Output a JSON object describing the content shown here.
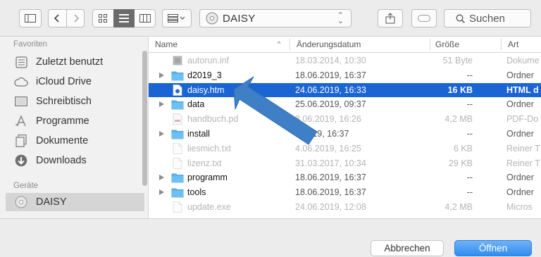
{
  "toolbar": {
    "path_label": "DAISY",
    "search_placeholder": "Suchen"
  },
  "sidebar": {
    "favorites_heading": "Favoriten",
    "favorites": [
      {
        "label": "Zuletzt benutzt",
        "icon": "recent-icon"
      },
      {
        "label": "iCloud Drive",
        "icon": "cloud-icon"
      },
      {
        "label": "Schreibtisch",
        "icon": "desktop-icon"
      },
      {
        "label": "Programme",
        "icon": "applications-icon"
      },
      {
        "label": "Dokumente",
        "icon": "documents-icon"
      },
      {
        "label": "Downloads",
        "icon": "downloads-icon"
      }
    ],
    "devices_heading": "Geräte",
    "devices": [
      {
        "label": "DAISY",
        "icon": "disc-icon"
      }
    ]
  },
  "columns": {
    "name": "Name",
    "date": "Änderungsdatum",
    "size": "Größe",
    "kind": "Art"
  },
  "files": [
    {
      "name": "autorun.inf",
      "date": "18.03.2014, 10:30",
      "size": "51 Byte",
      "kind": "Dokume",
      "type": "doc",
      "enabled": false
    },
    {
      "name": "d2019_3",
      "date": "18.06.2019, 16:37",
      "size": "--",
      "kind": "Ordner",
      "type": "folder",
      "enabled": true
    },
    {
      "name": "daisy.htm",
      "date": "24.06.2019, 16:33",
      "size": "16 KB",
      "kind": "HTML d",
      "type": "html",
      "enabled": true,
      "selected": true
    },
    {
      "name": "data",
      "date": "25.06.2019, 09:37",
      "size": "--",
      "kind": "Ordner",
      "type": "folder",
      "enabled": true
    },
    {
      "name": "handbuch.pd",
      "date": "8.06.2019, 16:26",
      "size": "4,2 MB",
      "kind": "PDF-Do",
      "type": "pdf",
      "enabled": false
    },
    {
      "name": "install",
      "date": "6.2019, 16:37",
      "size": "--",
      "kind": "Ordner",
      "type": "folder",
      "enabled": true
    },
    {
      "name": "liesmich.txt",
      "date": "4.06.2019, 16:25",
      "size": "6 KB",
      "kind": "Reiner T",
      "type": "txt",
      "enabled": false
    },
    {
      "name": "lizenz.txt",
      "date": "31.03.2017, 10:34",
      "size": "29 KB",
      "kind": "Reiner T",
      "type": "txt",
      "enabled": false
    },
    {
      "name": "programm",
      "date": "18.06.2019, 16:37",
      "size": "--",
      "kind": "Ordner",
      "type": "folder",
      "enabled": true
    },
    {
      "name": "tools",
      "date": "18.06.2019, 16:37",
      "size": "--",
      "kind": "Ordner",
      "type": "folder",
      "enabled": true
    },
    {
      "name": "update.exe",
      "date": "24.06.2019, 12:08",
      "size": "4,2 MB",
      "kind": "Micros",
      "type": "exe",
      "enabled": false
    }
  ],
  "buttons": {
    "cancel": "Abbrechen",
    "open": "Öffnen"
  },
  "colors": {
    "selection": "#1a64d3",
    "folder": "#5ab4ee",
    "accent": "#2f8df0",
    "arrow": "#3f7fc6"
  }
}
